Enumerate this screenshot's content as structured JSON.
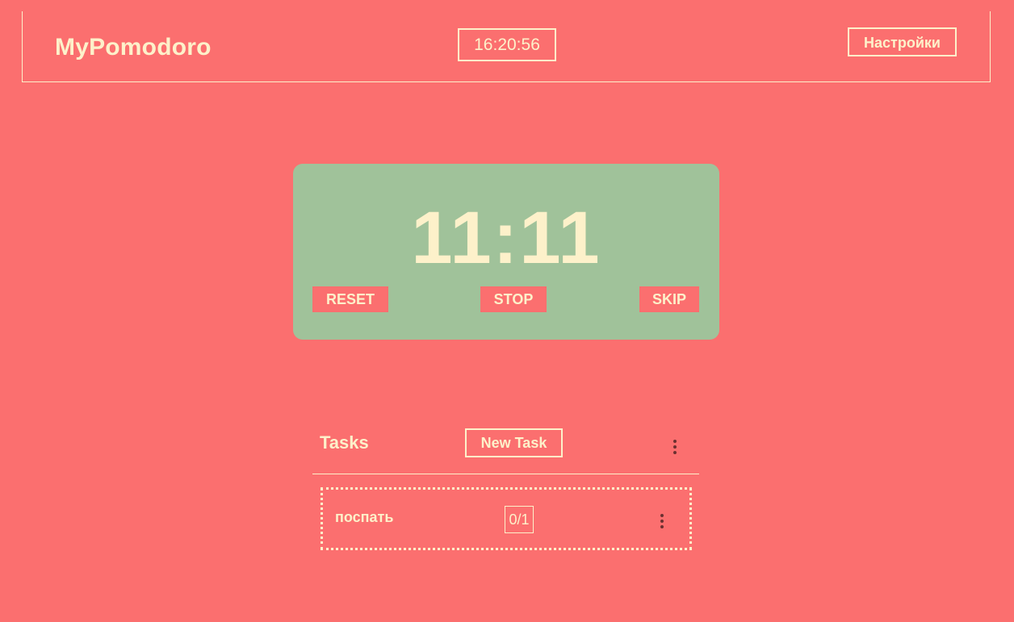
{
  "header": {
    "brand": "MyPomodoro",
    "clock": "16:20:56",
    "settings_label": "Настройки"
  },
  "timer": {
    "display": "11:11",
    "reset_label": "RESET",
    "stop_label": "STOP",
    "skip_label": "SKIP"
  },
  "tasks": {
    "title": "Tasks",
    "new_task_label": "New Task",
    "menu_icon": "kebab-menu-icon",
    "items": [
      {
        "name": "поспать",
        "progress": "0/1",
        "menu_icon": "kebab-menu-icon"
      }
    ]
  },
  "colors": {
    "background": "#fb6f6f",
    "timer_card": "#a0c29a",
    "text": "#fdf1ca",
    "icon": "#6b3030"
  }
}
